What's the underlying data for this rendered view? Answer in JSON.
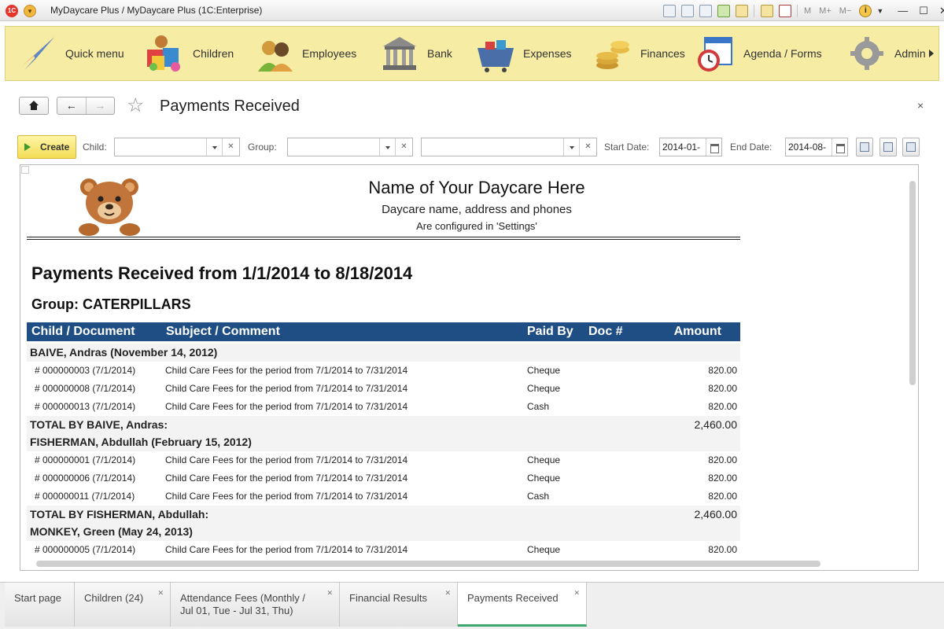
{
  "window": {
    "title": "MyDaycare Plus / MyDaycare Plus  (1C:Enterprise)"
  },
  "titlebar_icons": [
    "save-icon",
    "print-icon",
    "preview-icon",
    "favorites-icon",
    "star-icon",
    "calculator-icon",
    "calendar-icon"
  ],
  "titlebar_text": {
    "m": "M",
    "m_plus": "M+",
    "m_minus": "M−",
    "info": "i"
  },
  "sections": [
    {
      "label": "Quick menu",
      "icon": "quick-menu-icon"
    },
    {
      "label": "Children",
      "icon": "children-icon"
    },
    {
      "label": "Employees",
      "icon": "employees-icon"
    },
    {
      "label": "Bank",
      "icon": "bank-icon"
    },
    {
      "label": "Expenses",
      "icon": "expenses-icon"
    },
    {
      "label": "Finances",
      "icon": "finances-icon"
    },
    {
      "label": "Agenda / Forms",
      "icon": "agenda-icon"
    },
    {
      "label": "Admin",
      "icon": "admin-icon"
    }
  ],
  "form": {
    "title": "Payments Received",
    "close": "×"
  },
  "toolbar": {
    "create_label": "Create",
    "child_label": "Child:",
    "child_value": "",
    "group_label": "Group:",
    "group_value": "",
    "third_value": "",
    "start_label": "Start Date:",
    "start_value": "2014-01-",
    "end_label": "End Date:",
    "end_value": "2014-08-"
  },
  "report": {
    "daycare_name": "Name of Your Daycare Here",
    "daycare_sub1": "Daycare name, address and phones",
    "daycare_sub2": "Are configured in 'Settings'",
    "title": "Payments Received from 1/1/2014 to 8/18/2014",
    "group": "Group: CATERPILLARS",
    "columns": {
      "doc": "Child / Document",
      "subject": "Subject / Comment",
      "paid_by": "Paid By",
      "doc_no": "Doc #",
      "amount": "Amount"
    },
    "rows": [
      {
        "kind": "group",
        "doc": "BAIVE, Andras (November 14, 2012)"
      },
      {
        "kind": "item",
        "doc": "# 000000003 (7/1/2014)",
        "subject": "Child Care Fees for the period from 7/1/2014 to 7/31/2014",
        "paid_by": "Cheque",
        "amount": "820.00"
      },
      {
        "kind": "item",
        "doc": "# 000000008 (7/1/2014)",
        "subject": "Child Care Fees for the period from 7/1/2014 to 7/31/2014",
        "paid_by": "Cheque",
        "amount": "820.00"
      },
      {
        "kind": "item",
        "doc": "# 000000013 (7/1/2014)",
        "subject": "Child Care Fees for the period from 7/1/2014 to 7/31/2014",
        "paid_by": "Cash",
        "amount": "820.00"
      },
      {
        "kind": "total",
        "doc": "TOTAL BY BAIVE, Andras:",
        "amount": "2,460.00"
      },
      {
        "kind": "group",
        "doc": "FISHERMAN, Abdullah (February 15, 2012)"
      },
      {
        "kind": "item",
        "doc": "# 000000001 (7/1/2014)",
        "subject": "Child Care Fees for the period from 7/1/2014 to 7/31/2014",
        "paid_by": "Cheque",
        "amount": "820.00"
      },
      {
        "kind": "item",
        "doc": "# 000000006 (7/1/2014)",
        "subject": "Child Care Fees for the period from 7/1/2014 to 7/31/2014",
        "paid_by": "Cheque",
        "amount": "820.00"
      },
      {
        "kind": "item",
        "doc": "# 000000011 (7/1/2014)",
        "subject": "Child Care Fees for the period from 7/1/2014 to 7/31/2014",
        "paid_by": "Cash",
        "amount": "820.00"
      },
      {
        "kind": "total",
        "doc": "TOTAL BY FISHERMAN, Abdullah:",
        "amount": "2,460.00"
      },
      {
        "kind": "group",
        "doc": "MONKEY, Green (May 24, 2013)"
      },
      {
        "kind": "item",
        "doc": "# 000000005 (7/1/2014)",
        "subject": "Child Care Fees for the period from 7/1/2014 to 7/31/2014",
        "paid_by": "Cheque",
        "amount": "820.00"
      }
    ]
  },
  "tabs": [
    {
      "label": "Start page",
      "closable": false,
      "active": false
    },
    {
      "label": "Children (24)",
      "closable": true,
      "active": false
    },
    {
      "label": "Attendance Fees (Monthly / Jul 01, Tue - Jul 31, Thu)",
      "closable": true,
      "active": false
    },
    {
      "label": "Financial Results",
      "closable": true,
      "active": false
    },
    {
      "label": "Payments Received",
      "closable": true,
      "active": true
    }
  ],
  "colors": {
    "section_bg": "#f7eca4",
    "table_header": "#1f4e85",
    "create_button": "#f3dd56",
    "active_tab_underline": "#3aa86a"
  }
}
